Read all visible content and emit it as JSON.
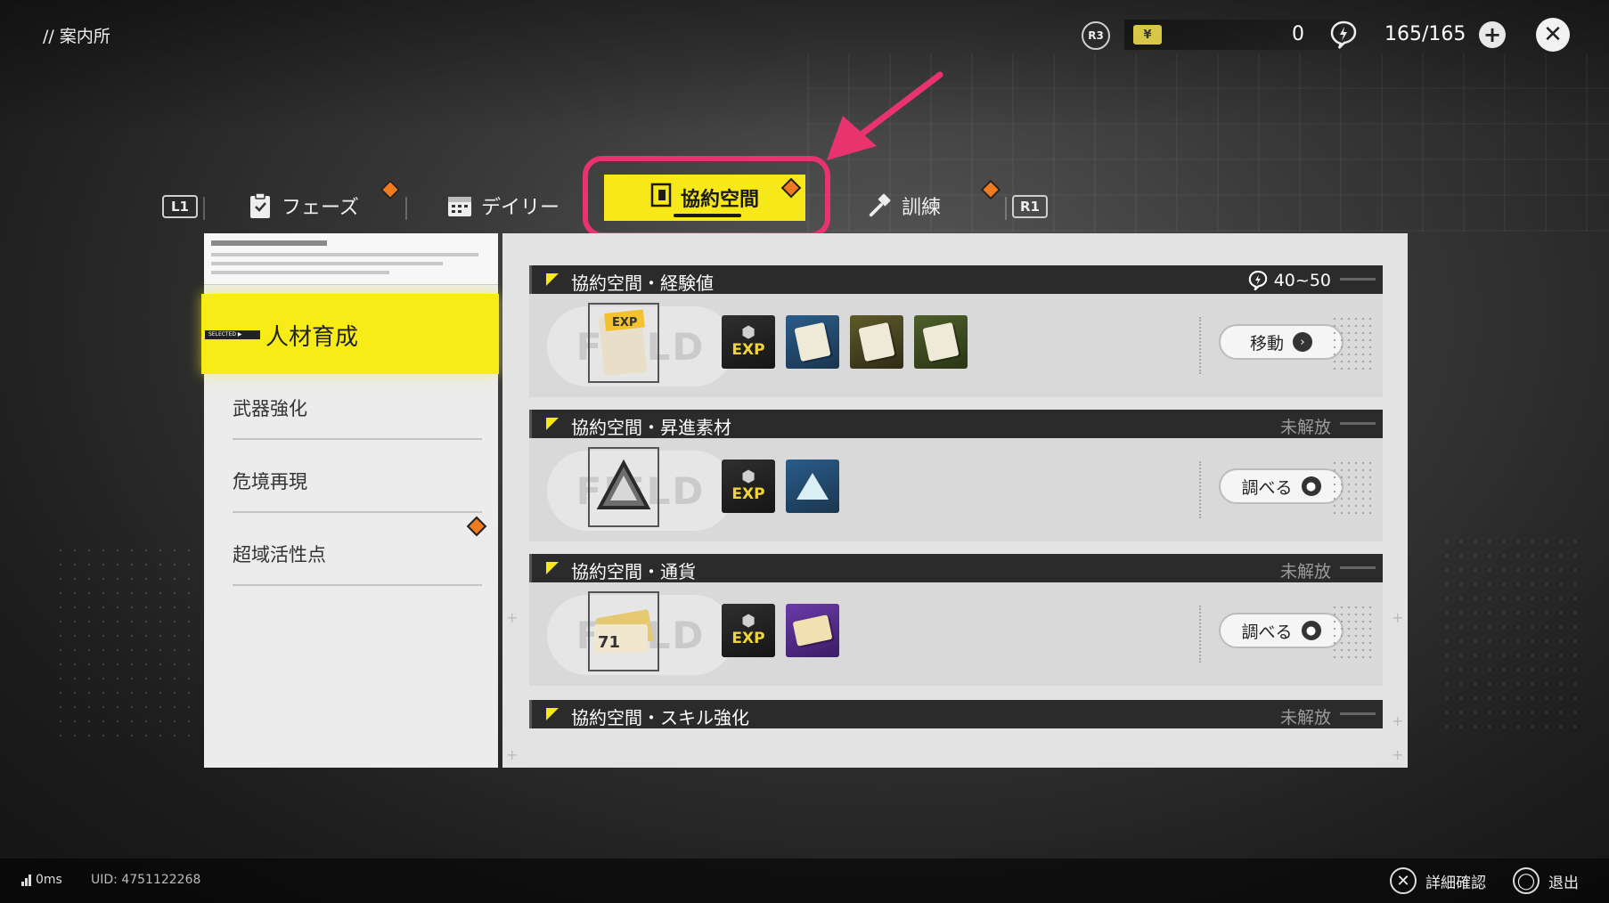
{
  "header": {
    "title": "// 案内所",
    "r3_label": "R3",
    "currency_value": "0",
    "stamina_value": "165/165",
    "add_symbol": "+",
    "close_symbol": "✕"
  },
  "tabs": {
    "left_button": "L1",
    "right_button": "R1",
    "items": [
      {
        "label": "フェーズ",
        "icon": "clipboard-icon"
      },
      {
        "label": "デイリー",
        "icon": "calendar-icon"
      },
      {
        "label": "協約空間",
        "icon": "contract-space-icon",
        "active": true
      },
      {
        "label": "訓練",
        "icon": "hammer-icon"
      }
    ]
  },
  "sidebar": {
    "selected_tag": "SELECTED ▶",
    "items": [
      {
        "label": "人材育成",
        "selected": true
      },
      {
        "label": "武器強化"
      },
      {
        "label": "危境再現"
      },
      {
        "label": "超域活性点",
        "notification": true
      }
    ]
  },
  "sections": [
    {
      "title": "協約空間・経験値",
      "cost": "40~50",
      "button_label": "移動",
      "button_icon": "chevron-right-icon",
      "rewards": [
        "exp-chip",
        "exp-card-blue",
        "exp-card-gold",
        "exp-card-green"
      ]
    },
    {
      "title": "協約空間・昇進素材",
      "status": "未解放",
      "button_label": "調べる",
      "button_icon": "location-pin-icon",
      "rewards": [
        "exp-chip",
        "promotion-crystal"
      ]
    },
    {
      "title": "協約空間・通貨",
      "status": "未解放",
      "button_label": "調べる",
      "button_icon": "location-pin-icon",
      "rewards": [
        "exp-chip",
        "currency-ticket"
      ]
    },
    {
      "title": "協約空間・スキル強化",
      "status": "未解放"
    }
  ],
  "exp_label": "EXP",
  "footer": {
    "ping": "0ms",
    "uid": "UID: 4751122268",
    "hint_detail": "詳細確認",
    "hint_exit": "退出"
  },
  "colors": {
    "accent_yellow": "#f7e81a",
    "highlight_pink": "#e8336f",
    "notification_orange": "#f07a1e"
  }
}
